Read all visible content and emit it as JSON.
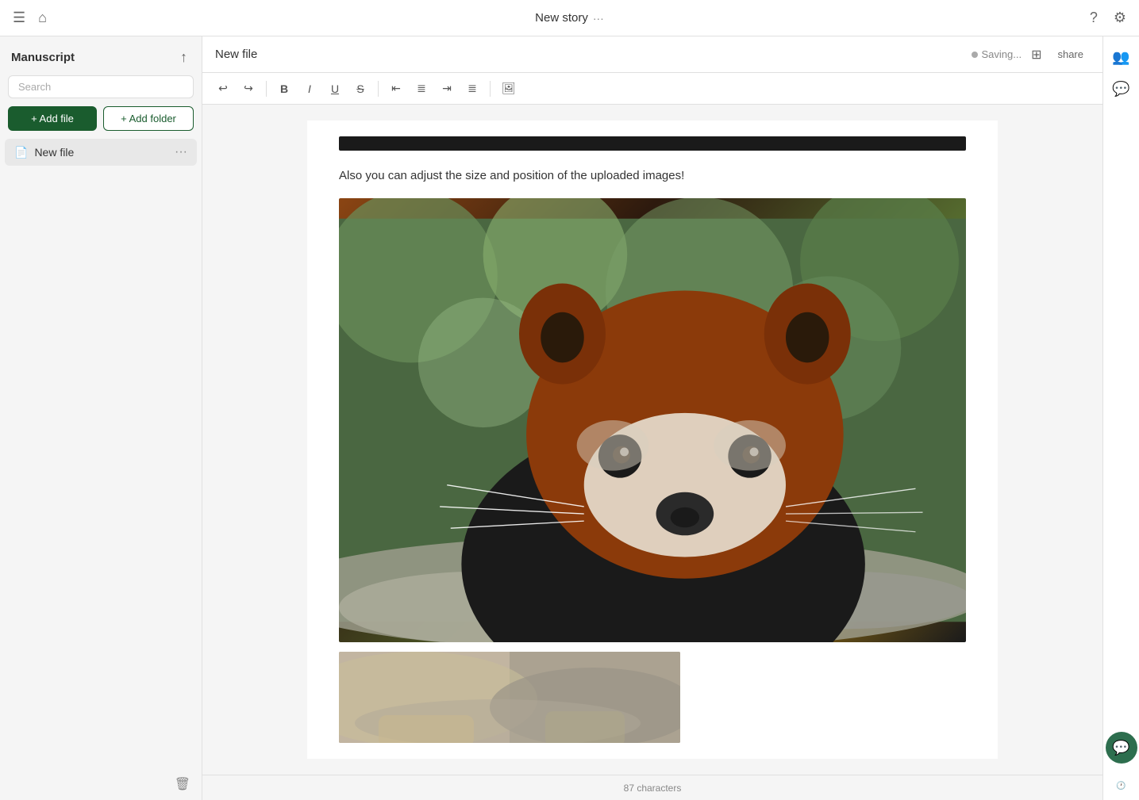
{
  "topbar": {
    "menu_icon": "☰",
    "home_icon": "⌂",
    "story_title": "New story",
    "dots": "···",
    "help_icon": "?",
    "settings_icon": "⚙"
  },
  "sidebar": {
    "title": "Manuscript",
    "upload_icon": "↑",
    "search_placeholder": "Search",
    "add_file_label": "+ Add file",
    "add_folder_label": "+ Add folder",
    "files": [
      {
        "name": "New file",
        "icon": "📄"
      }
    ],
    "trash_icon": "🗑"
  },
  "editor": {
    "file_title": "New file",
    "saving_status": "Saving...",
    "layout_icon": "⊞",
    "share_label": "share",
    "toolbar": {
      "undo": "↩",
      "redo": "↪",
      "bold": "B",
      "italic": "I",
      "underline": "U",
      "strikethrough": "S",
      "align_left": "≡",
      "align_center": "≡",
      "align_right": "≡",
      "align_justify": "≡",
      "image": "⬛"
    },
    "content_text": "Also you can adjust the size and position of the uploaded images!",
    "char_count": "87 characters"
  },
  "right_sidebar": {
    "people_icon": "👥",
    "comment_icon": "💬",
    "chat_icon": "💬",
    "clock_icon": "🕐"
  }
}
